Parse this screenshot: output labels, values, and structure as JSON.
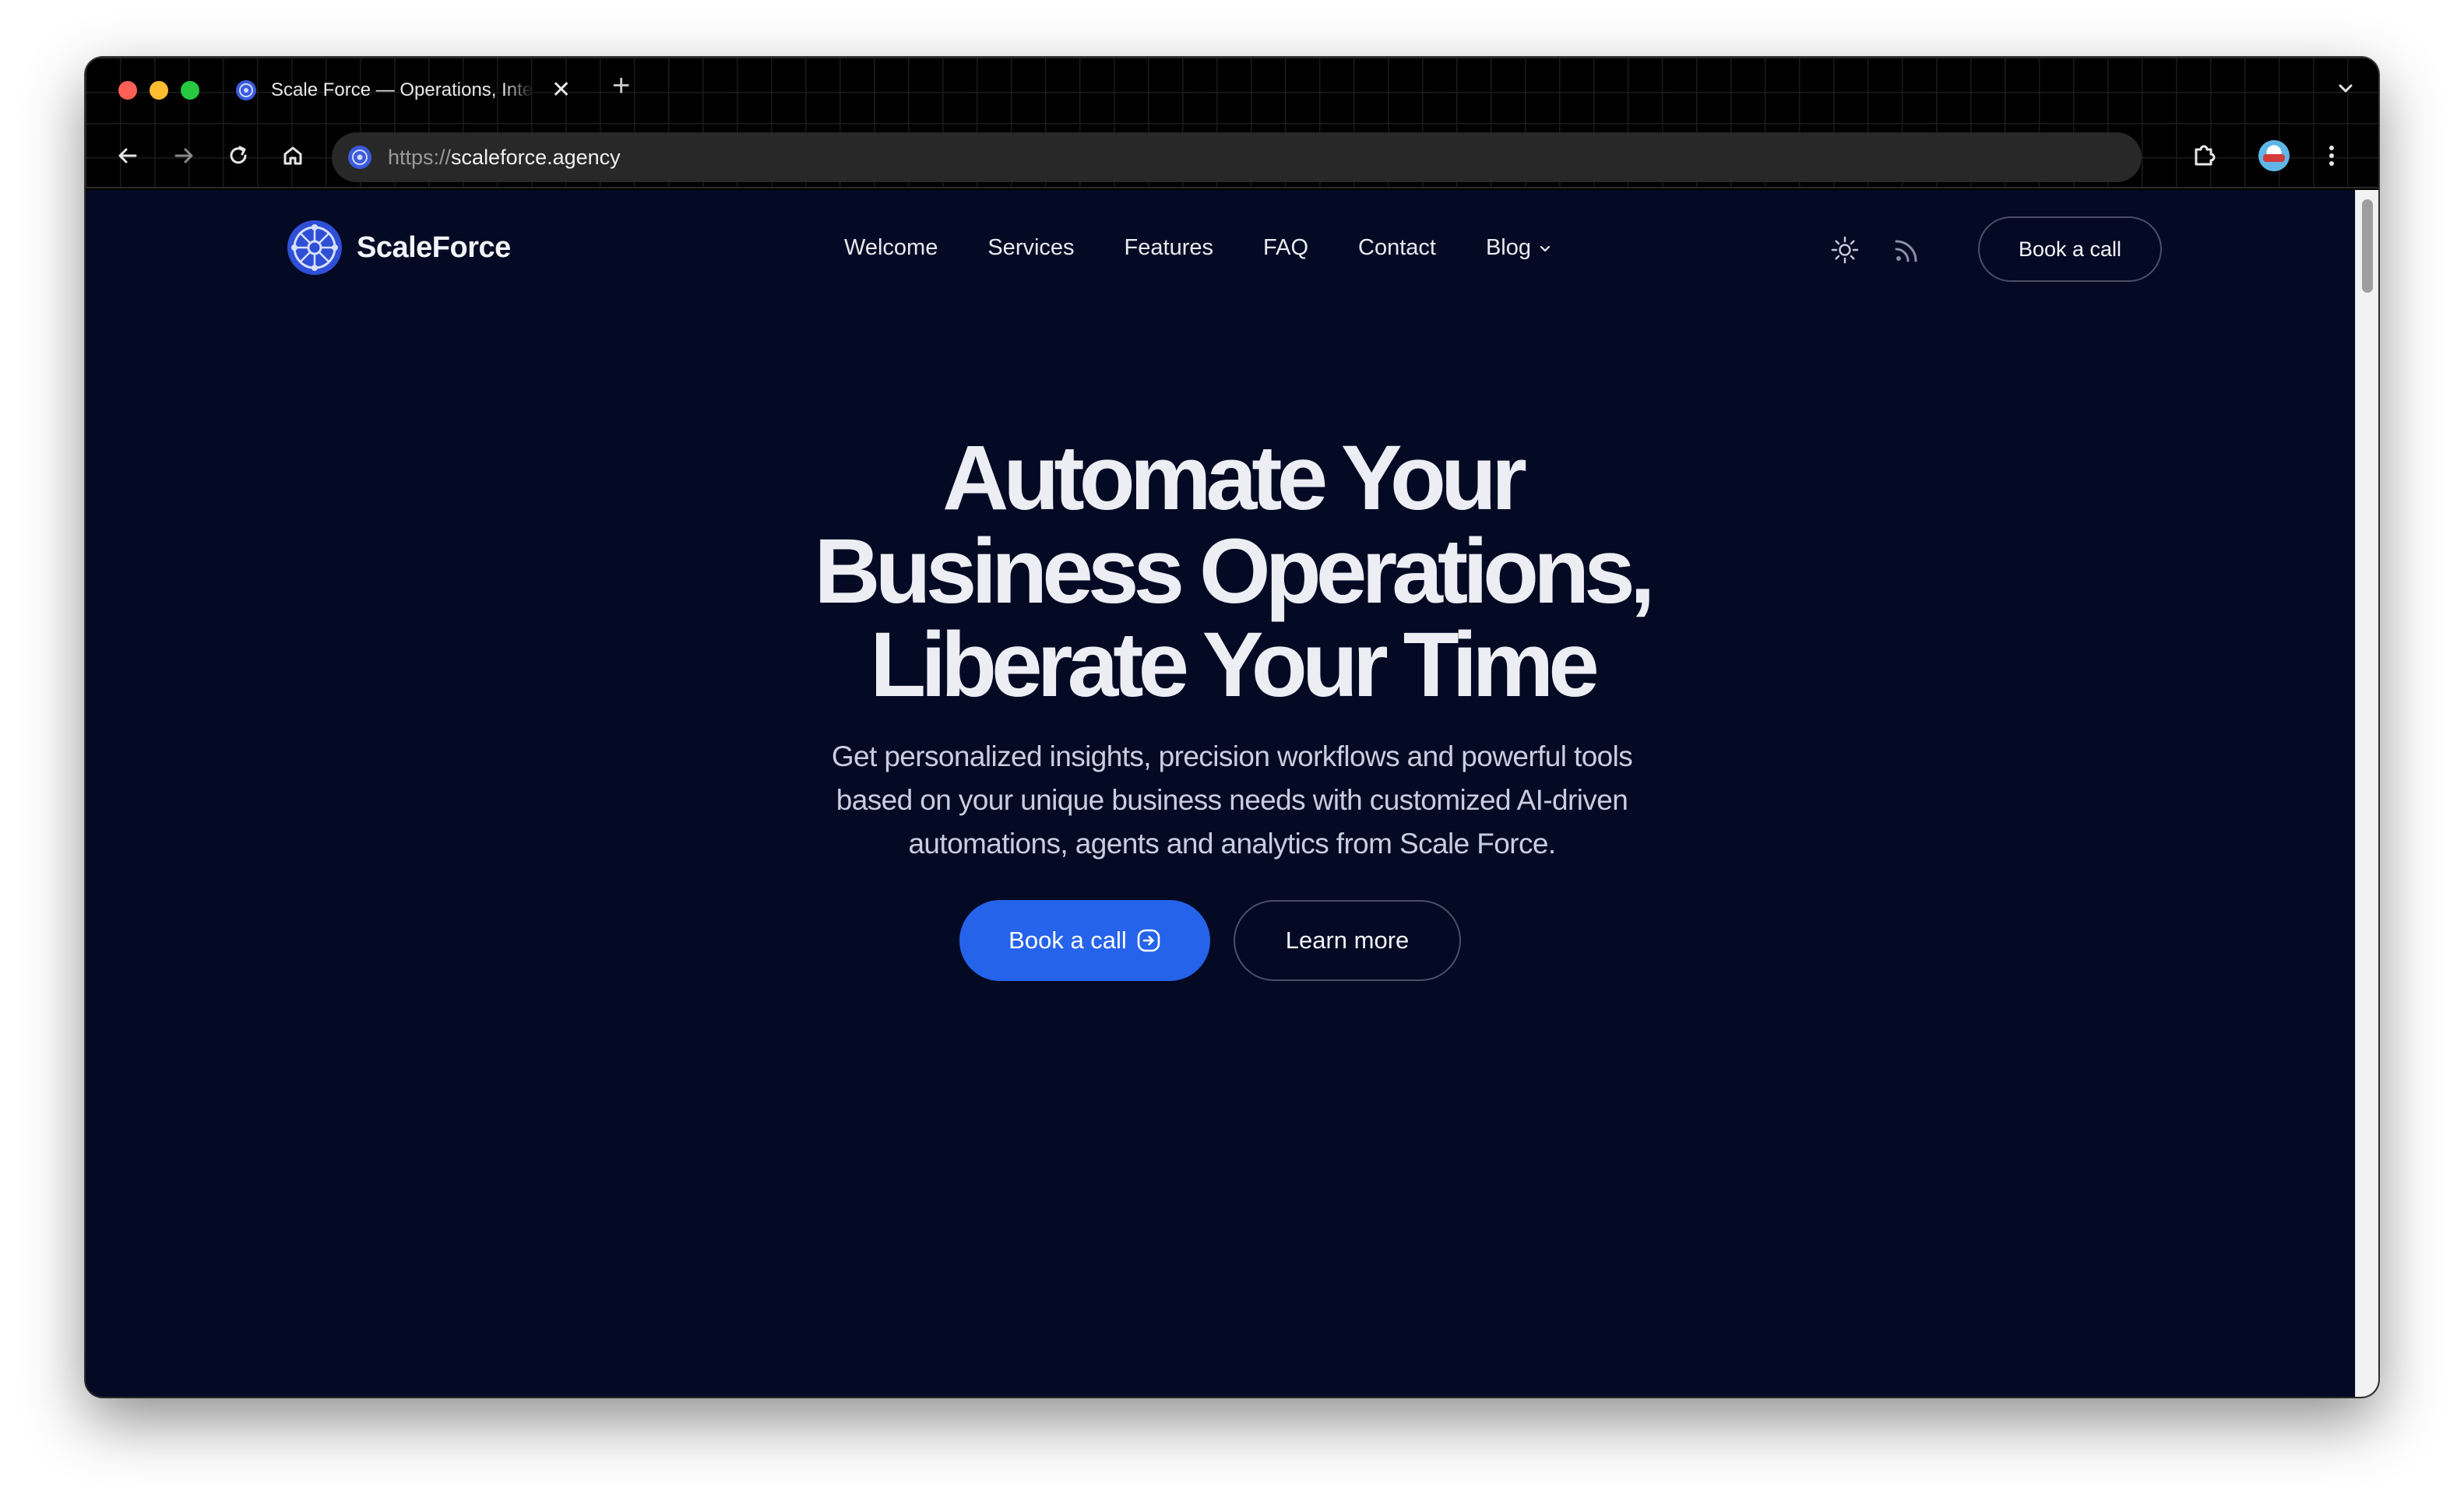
{
  "browser": {
    "tab_title": "Scale Force — Operations, Intelligence",
    "tab_close": "✕",
    "new_tab": "+",
    "url_scheme": "https://",
    "url_host": "scaleforce.agency"
  },
  "site": {
    "brand": "ScaleForce",
    "nav": {
      "welcome": "Welcome",
      "services": "Services",
      "features": "Features",
      "faq": "FAQ",
      "contact": "Contact",
      "blog": "Blog"
    },
    "nav_cta": "Book a call"
  },
  "hero": {
    "title_line1": "Automate Your",
    "title_line2": "Business Operations,",
    "title_line3": "Liberate Your Time",
    "subtitle_line1": "Get personalized insights, precision workflows and powerful tools",
    "subtitle_line2": "based on your unique business needs with customized AI-driven",
    "subtitle_line3": "automations, agents and analytics from Scale Force.",
    "primary_cta": "Book a call",
    "secondary_cta": "Learn more"
  },
  "colors": {
    "page_background": "#050a24",
    "primary": "#2563eb",
    "heading": "#eceef4",
    "body_text": "#c9cde0"
  },
  "icons": [
    "scaleforce-logo-icon",
    "back-arrow-icon",
    "forward-arrow-icon",
    "reload-icon",
    "home-icon",
    "extensions-icon",
    "more-vert-icon",
    "sun-icon",
    "rss-icon",
    "chevron-down-icon",
    "arrow-right-circle-icon"
  ]
}
